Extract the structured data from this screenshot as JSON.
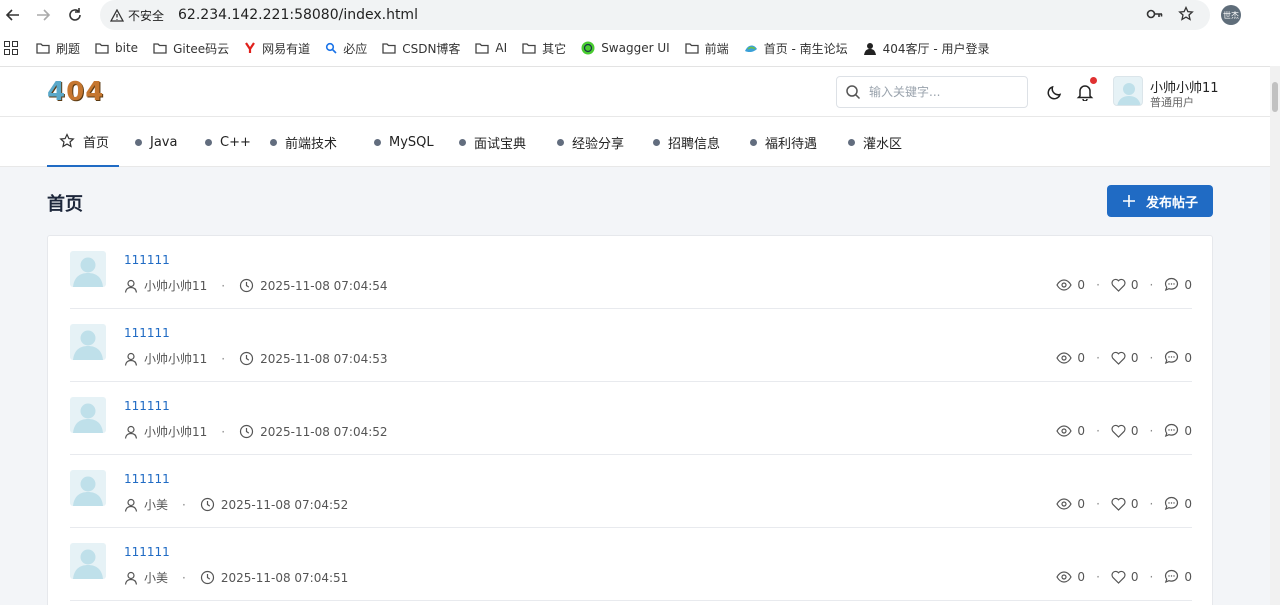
{
  "browser": {
    "security_label": "不安全",
    "url": "62.234.142.221:58080/index.html",
    "profile_label": "世杰"
  },
  "bookmarks": [
    {
      "label": "刷题",
      "icon": "folder-icon"
    },
    {
      "label": "bite",
      "icon": "folder-icon"
    },
    {
      "label": "Gitee码云",
      "icon": "folder-icon"
    },
    {
      "label": "网易有道",
      "icon": "youdao-icon"
    },
    {
      "label": "必应",
      "icon": "bing-icon"
    },
    {
      "label": "CSDN博客",
      "icon": "folder-icon"
    },
    {
      "label": "AI",
      "icon": "folder-icon"
    },
    {
      "label": "其它",
      "icon": "folder-icon"
    },
    {
      "label": "Swagger UI",
      "icon": "swagger-icon"
    },
    {
      "label": "前端",
      "icon": "folder-icon"
    },
    {
      "label": "首页 - 南生论坛",
      "icon": "site-icon"
    },
    {
      "label": "404客厅 - 用户登录",
      "icon": "site-icon"
    }
  ],
  "header": {
    "logo_text": "404",
    "search_placeholder": "输入关键字...",
    "user": {
      "name": "小帅小帅11",
      "role": "普通用户"
    }
  },
  "nav": {
    "tabs": [
      {
        "label": "首页"
      },
      {
        "label": "Java"
      },
      {
        "label": "C++"
      },
      {
        "label": "前端技术"
      },
      {
        "label": "MySQL"
      },
      {
        "label": "面试宝典"
      },
      {
        "label": "经验分享"
      },
      {
        "label": "招聘信息"
      },
      {
        "label": "福利待遇"
      },
      {
        "label": "灌水区"
      }
    ]
  },
  "main": {
    "page_title": "首页",
    "post_button": "发布帖子",
    "posts": [
      {
        "title": "111111",
        "author": "小帅小帅11",
        "time": "2025-11-08 07:04:54",
        "views": "0",
        "likes": "0",
        "comments": "0"
      },
      {
        "title": "111111",
        "author": "小帅小帅11",
        "time": "2025-11-08 07:04:53",
        "views": "0",
        "likes": "0",
        "comments": "0"
      },
      {
        "title": "111111",
        "author": "小帅小帅11",
        "time": "2025-11-08 07:04:52",
        "views": "0",
        "likes": "0",
        "comments": "0"
      },
      {
        "title": "111111",
        "author": "小美",
        "time": "2025-11-08 07:04:52",
        "views": "0",
        "likes": "0",
        "comments": "0"
      },
      {
        "title": "111111",
        "author": "小美",
        "time": "2025-11-08 07:04:51",
        "views": "0",
        "likes": "0",
        "comments": "0"
      }
    ]
  }
}
